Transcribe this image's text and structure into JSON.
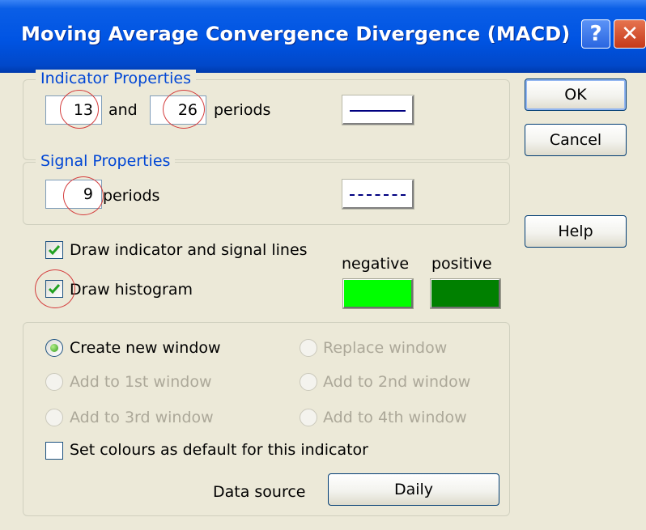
{
  "window": {
    "title": "Moving Average Convergence Divergence (MACD)",
    "help_glyph": "?",
    "close_glyph": "✕"
  },
  "indicator": {
    "legend": "Indicator Properties",
    "fast_period": "13",
    "and_label": "and",
    "slow_period": "26",
    "periods_label": "periods",
    "line_style": "solid",
    "line_color": "#000080"
  },
  "signal": {
    "legend": "Signal Properties",
    "period": "9",
    "periods_label": "periods",
    "line_style": "dashed",
    "line_color": "#000080"
  },
  "options": {
    "draw_lines_label": "Draw indicator and signal lines",
    "draw_lines_checked": true,
    "draw_histogram_label": "Draw histogram",
    "draw_histogram_checked": true,
    "negative_label": "negative",
    "positive_label": "positive",
    "negative_color": "#00ff00",
    "positive_color": "#008000"
  },
  "placement": {
    "create_new": "Create new window",
    "replace": "Replace window",
    "add_1st": "Add to 1st window",
    "add_2nd": "Add to 2nd window",
    "add_3rd": "Add to 3rd window",
    "add_4th": "Add to 4th window",
    "selected": "create_new",
    "set_default_label": "Set colours as default for this indicator",
    "set_default_checked": false,
    "data_source_label": "Data source",
    "data_source_value": "Daily"
  },
  "buttons": {
    "ok": "OK",
    "cancel": "Cancel",
    "help": "Help"
  },
  "icons": {
    "help": "help-icon",
    "close": "close-icon",
    "check": "checkmark-icon",
    "radio": "radio-dot-icon"
  },
  "colors": {
    "title_bar": "#0054e3",
    "legend_text": "#0046d5",
    "annotation_circle": "#d43c3c"
  }
}
